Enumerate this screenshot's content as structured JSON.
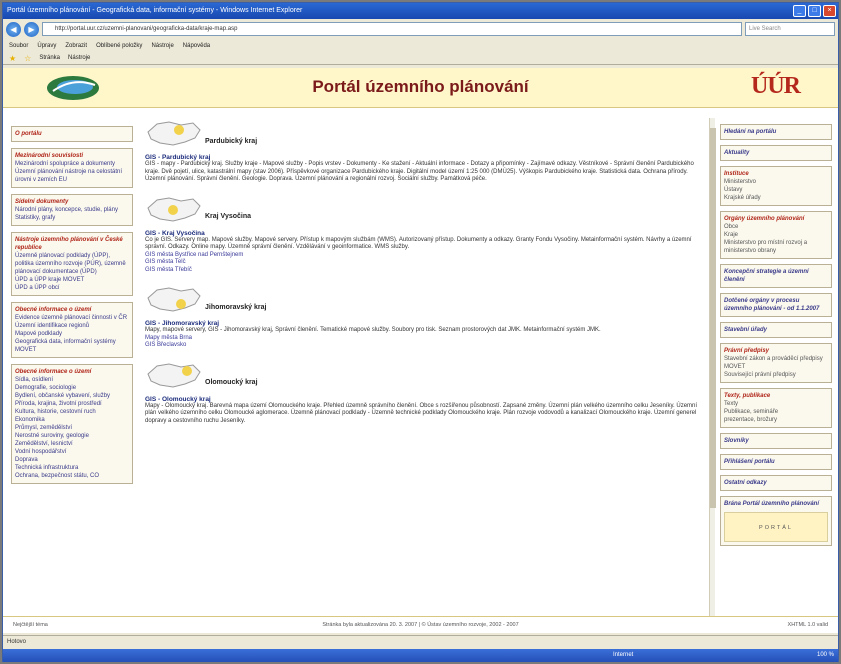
{
  "window": {
    "title": "Portál územního plánování - Geografická data, informační systémy - Windows Internet Explorer",
    "address": "http://portal.uur.cz/uzemni-planovani/geograficka-data/kraje-map.asp",
    "search_placeholder": "Live Search"
  },
  "menu": [
    "Soubor",
    "Úpravy",
    "Zobrazit",
    "Oblíbené položky",
    "Nástroje",
    "Nápověda"
  ],
  "favbar": [
    "Stránka",
    "Nástroje"
  ],
  "header": {
    "title": "Portál územního plánování",
    "logo_right": "ÚÚR"
  },
  "left_nav": [
    {
      "heading": "O portálu",
      "items": []
    },
    {
      "heading": "Mezinárodní souvislosti",
      "items": [
        "Mezinárodní spolupráce a dokumenty",
        "Územní plánování nástroje na celostátní úrovni v zemích EU"
      ]
    },
    {
      "heading": "Sídelní dokumenty",
      "items": [
        "Národní plány, koncepce, studie, plány",
        "Statistiky, grafy"
      ]
    },
    {
      "heading": "Nástroje územního plánování v České republice",
      "items": [
        "Územně plánovací podklady (ÚPP), politika územního rozvoje (PÚR), územně plánovací dokumentace (ÚPD)",
        "ÚPD a ÚPP kraje MOVET",
        "ÚPD a ÚPP obcí"
      ]
    },
    {
      "heading": "Obecné informace o území",
      "items": [
        "Evidence územně plánovací činnosti v ČR",
        "Územní identifikace regionů",
        "Mapové podklady",
        "Geografická data, informační systémy MOVET"
      ]
    },
    {
      "heading": "Obecné informace o území",
      "items": [
        "Sídla, osídlení",
        "Demografie, sociologie",
        "Bydlení, občanské vybavení, služby",
        "Příroda, krajina, životní prostředí",
        "Kultura, historie, cestovní ruch",
        "Ekonomika",
        "Průmysl, zemědělství",
        "Nerostné suroviny, geologie",
        "Zemědělství, lesnictví",
        "Vodní hospodářství",
        "Doprava",
        "Technická infrastruktura",
        "Ochrana, bezpečnost státu, CO"
      ]
    }
  ],
  "regions": [
    {
      "name": "Pardubický kraj",
      "heading": "GIS - Pardubický kraj",
      "desc": "GIS - mapy - Pardubický kraj. Služby kraje - Mapové služby - Popis vrstev - Dokumenty - Ke stažení - Aktuální informace - Dotazy a připomínky - Zajímavé odkazy. Věstníkové - Správní členění Pardubického kraje. Dvě pojetí, ulice, katastrální mapy (stav 2006). Příspěvkové organizace Pardubického kraje. Digitální model území 1:25 000 (DMÚ25). Výškopis Pardubického kraje. Statistická data. Ochrana přírody. Územní plánování. Správní členění. Geologie. Doprava. Územní plánování a regionální rozvoj. Sociální služby. Památková péče.",
      "links": []
    },
    {
      "name": "Kraj Vysočina",
      "heading": "GIS - Kraj Vysočina",
      "desc": "Co je GIS. Servery map. Mapové služby. Mapové servery. Přístup k mapovým službám (WMS). Autorizovaný přístup. Dokumenty a odkazy. Granty Fondu Vysočiny. Metainformační systém. Návrhy a územní správní. Odkazy. Online mapy. Územně správní členění. Vzdělávání v geoinformatice. WMS služby.",
      "links": [
        "GIS města Bystřice nad Pernštejnem",
        "GIS města Telč",
        "GIS města Třebíč"
      ]
    },
    {
      "name": "Jihomoravský kraj",
      "heading": "GIS - Jihomoravský kraj",
      "desc": "Mapy, mapové servery, GIS - Jihomoravský kraj, Správní členění. Tematické mapové služby. Soubory pro tisk. Seznam prostorových dat JMK. Metainformační systém JMK.",
      "links": [
        "Mapy města Brna",
        "GIS Břeclavsko"
      ]
    },
    {
      "name": "Olomoucký kraj",
      "heading": "GIS - Olomoucký kraj",
      "desc": "Mapy - Olomoucký kraj. Barevná mapa území Olomouckého kraje. Přehled územně správního členění. Obce s rozšířenou působností. Zapsané změny. Územní plán velkého územního celku Jeseníky. Územní plán velkého územního celku Olomoucké aglomerace. Územně plánovací podklady - Územně technické podklady Olomouckého kraje. Plán rozvoje vodovodů a kanalizací Olomouckého kraje. Územní generel dopravy a cestovního ruchu Jeseníky.",
      "links": []
    }
  ],
  "right_nav": [
    {
      "heading": "Hledání na portálu",
      "items": [],
      "red": false
    },
    {
      "heading": "Aktuality",
      "items": [],
      "red": false
    },
    {
      "heading": "Instituce",
      "items": [
        "Ministerstvo",
        "Ústavy",
        "Krajské úřady"
      ],
      "red": true
    },
    {
      "heading": "Orgány územního plánování",
      "items": [
        "Obce",
        "Kraje",
        "Ministerstvo pro místní rozvoj a ministerstvo obrany"
      ],
      "red": true
    },
    {
      "heading": "Koncepční strategie a územní členění",
      "items": [],
      "red": false
    },
    {
      "heading": "Dotčené orgány v procesu územního plánování - od 1.1.2007",
      "items": [],
      "red": false
    },
    {
      "heading": "Stavební úřady",
      "items": [],
      "red": false
    },
    {
      "heading": "Právní předpisy",
      "items": [
        "Stavební zákon a prováděcí předpisy MOVET",
        "Související právní předpisy"
      ],
      "red": true
    },
    {
      "heading": "Texty, publikace",
      "items": [
        "Texty",
        "Publikace, semináře",
        "prezentace, brožury"
      ],
      "red": true
    },
    {
      "heading": "Slovníky",
      "items": [],
      "red": false
    },
    {
      "heading": "Přihlášení portálu",
      "items": [],
      "red": false
    },
    {
      "heading": "Ostatní odkazy",
      "items": [],
      "red": false
    },
    {
      "heading": "Brána Portál územního plánování",
      "items": [],
      "red": false
    }
  ],
  "partner_text": "PORTÁL",
  "footer": {
    "left": "Nejčtější téma",
    "center": "Stránka byla aktualizována 20. 3. 2007 | © Ústav územního rozvoje, 2002 - 2007",
    "right": "XHTML 1.0 valid"
  },
  "status": "Hotovo",
  "taskbar": {
    "internet": "Internet",
    "zoom": "100 %"
  }
}
